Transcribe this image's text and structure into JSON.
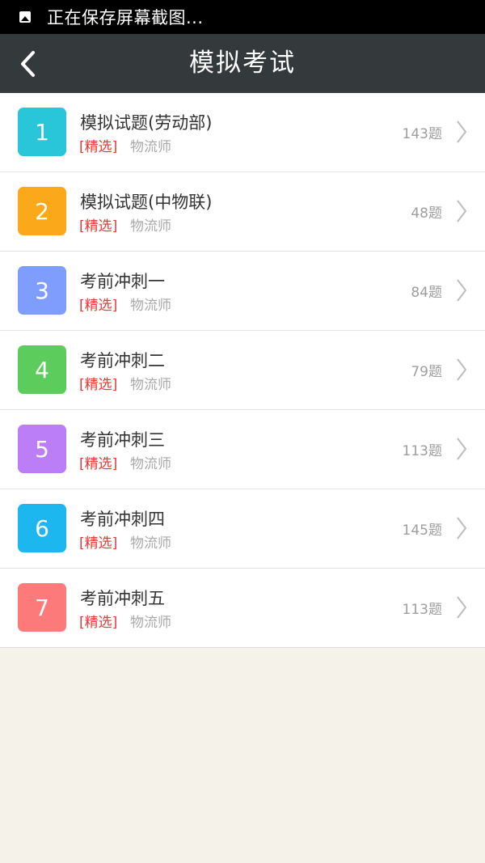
{
  "status_bar": {
    "notification_text": "正在保存屏幕截图..."
  },
  "header": {
    "title": "模拟考试",
    "back_icon": "chevron-left-icon"
  },
  "list": {
    "items": [
      {
        "number": "1",
        "title": "模拟试题(劳动部)",
        "tag": "[精选]",
        "category": "物流师",
        "count": "143题",
        "color": "#29c6d9"
      },
      {
        "number": "2",
        "title": "模拟试题(中物联)",
        "tag": "[精选]",
        "category": "物流师",
        "count": "48题",
        "color": "#fba81a"
      },
      {
        "number": "3",
        "title": "考前冲刺一",
        "tag": "[精选]",
        "category": "物流师",
        "count": "84题",
        "color": "#7f9dfc"
      },
      {
        "number": "4",
        "title": "考前冲刺二",
        "tag": "[精选]",
        "category": "物流师",
        "count": "79题",
        "color": "#5ccd5c"
      },
      {
        "number": "5",
        "title": "考前冲刺三",
        "tag": "[精选]",
        "category": "物流师",
        "count": "113题",
        "color": "#bb7ef6"
      },
      {
        "number": "6",
        "title": "考前冲刺四",
        "tag": "[精选]",
        "category": "物流师",
        "count": "145题",
        "color": "#1bb7ee"
      },
      {
        "number": "7",
        "title": "考前冲刺五",
        "tag": "[精选]",
        "category": "物流师",
        "count": "113题",
        "color": "#fd7a7a"
      }
    ]
  },
  "colors": {
    "status_bar": "#000000",
    "header": "#34393b",
    "background": "#f5f2ea",
    "tag": "#e53935"
  }
}
